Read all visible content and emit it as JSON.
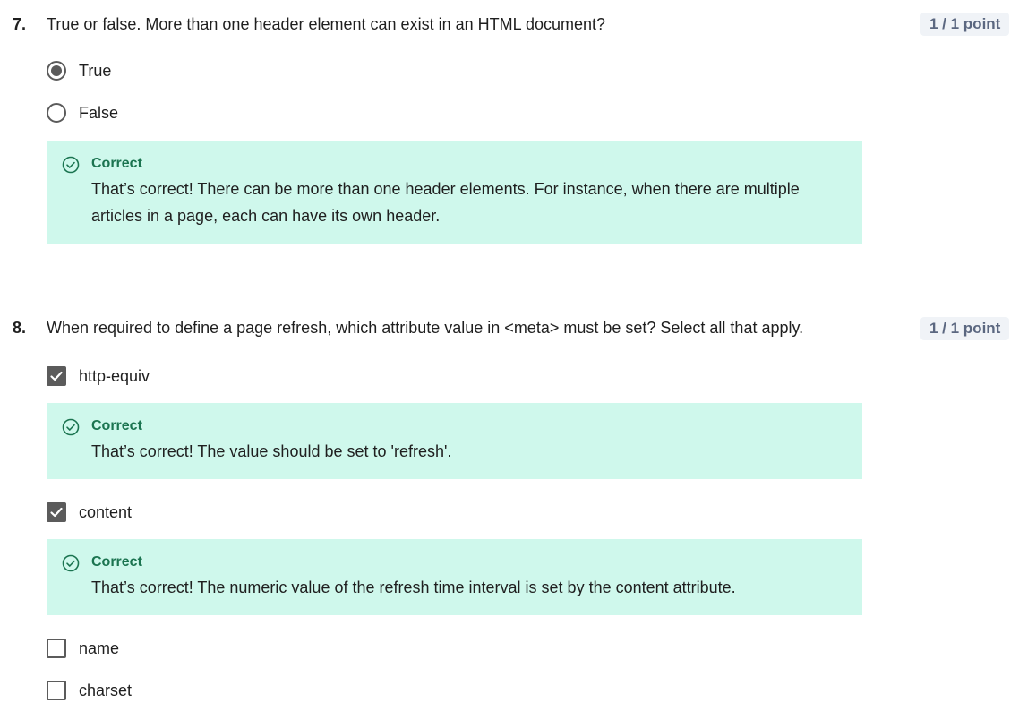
{
  "colors": {
    "feedback_bg": "#cff8ec",
    "correct_green": "#1b7450",
    "points_bg": "#f0f3f7",
    "points_text": "#5b6780",
    "control_gray": "#5b5b5b"
  },
  "questions": [
    {
      "number": "7.",
      "text": "True or false. More than one header element can exist in an HTML document?",
      "points": "1 / 1 point",
      "type": "radio",
      "options": [
        {
          "label": "True",
          "selected": true
        },
        {
          "label": "False",
          "selected": false
        }
      ],
      "feedback": {
        "icon": "check-circle-icon",
        "title": "Correct",
        "text_line1": "That’s correct! There can be more than one header elements. For instance, when there are multiple",
        "text_line2": "articles in a page, each can have its own header."
      }
    },
    {
      "number": "8.",
      "text": "When required to define a page refresh, which attribute value in <meta> must be set? Select all that apply.",
      "points": "1 / 1 point",
      "type": "checkbox",
      "options": [
        {
          "label": "http-equiv",
          "checked": true,
          "feedback": {
            "icon": "check-circle-icon",
            "title": "Correct",
            "text": "That’s correct! The value should be set to 'refresh'."
          }
        },
        {
          "label": "content",
          "checked": true,
          "feedback": {
            "icon": "check-circle-icon",
            "title": "Correct",
            "text": "That’s correct! The numeric value of the refresh time interval is set by the content attribute."
          }
        },
        {
          "label": "name",
          "checked": false
        },
        {
          "label": "charset",
          "checked": false
        }
      ]
    }
  ]
}
